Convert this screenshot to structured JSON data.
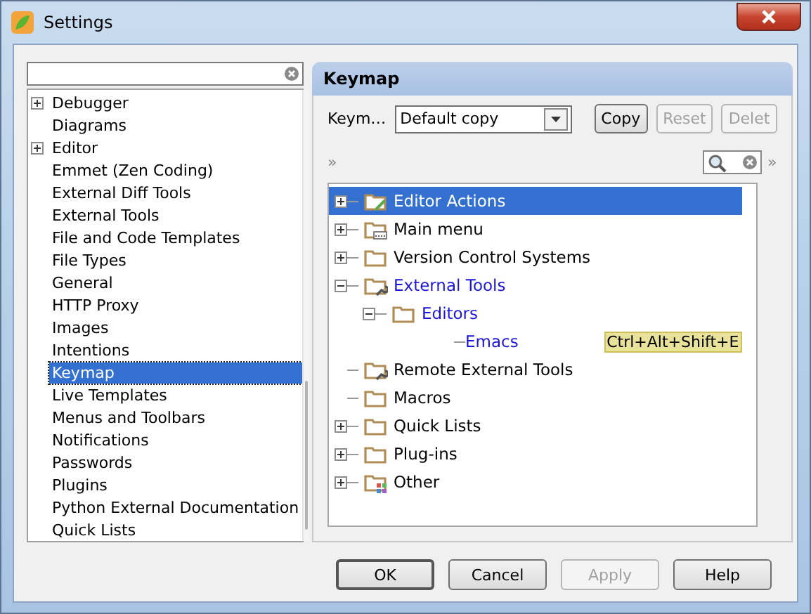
{
  "window": {
    "title": "Settings"
  },
  "sidebar": {
    "items": [
      {
        "label": "Debugger",
        "kind": "group",
        "selected": false
      },
      {
        "label": "Diagrams",
        "kind": "leaf",
        "selected": false
      },
      {
        "label": "Editor",
        "kind": "group",
        "selected": false
      },
      {
        "label": "Emmet (Zen Coding)",
        "kind": "leaf",
        "selected": false
      },
      {
        "label": "External Diff Tools",
        "kind": "leaf",
        "selected": false
      },
      {
        "label": "External Tools",
        "kind": "leaf",
        "selected": false
      },
      {
        "label": "File and Code Templates",
        "kind": "leaf",
        "selected": false
      },
      {
        "label": "File Types",
        "kind": "leaf",
        "selected": false
      },
      {
        "label": "General",
        "kind": "leaf",
        "selected": false
      },
      {
        "label": "HTTP Proxy",
        "kind": "leaf",
        "selected": false
      },
      {
        "label": "Images",
        "kind": "leaf",
        "selected": false
      },
      {
        "label": "Intentions",
        "kind": "leaf",
        "selected": false
      },
      {
        "label": "Keymap",
        "kind": "leaf",
        "selected": true
      },
      {
        "label": "Live Templates",
        "kind": "leaf",
        "selected": false
      },
      {
        "label": "Menus and Toolbars",
        "kind": "leaf",
        "selected": false
      },
      {
        "label": "Notifications",
        "kind": "leaf",
        "selected": false
      },
      {
        "label": "Passwords",
        "kind": "leaf",
        "selected": false
      },
      {
        "label": "Plugins",
        "kind": "leaf",
        "selected": false
      },
      {
        "label": "Python External Documentation",
        "kind": "leaf",
        "selected": false
      },
      {
        "label": "Quick Lists",
        "kind": "leaf",
        "selected": false
      }
    ]
  },
  "panel": {
    "title": "Keymap",
    "keymap_label": "Keym…",
    "keymap_value": "Default copy",
    "buttons": [
      {
        "label": "Copy",
        "disabled": false
      },
      {
        "label": "Reset",
        "disabled": true
      },
      {
        "label": "Delet",
        "disabled": true
      }
    ],
    "expand_left": "»",
    "expand_right": "»",
    "tree": [
      {
        "label": "Editor Actions",
        "kind": "edit",
        "expanded": false,
        "selected": true,
        "modified": false
      },
      {
        "label": "Main menu",
        "kind": "menu",
        "expanded": false,
        "selected": false,
        "modified": false
      },
      {
        "label": "Version Control Systems",
        "kind": "folder",
        "expanded": false,
        "selected": false,
        "modified": false
      },
      {
        "label": "External Tools",
        "kind": "tools",
        "expanded": true,
        "selected": false,
        "modified": true,
        "children": [
          {
            "label": "Editors",
            "kind": "folder",
            "expanded": true,
            "selected": false,
            "modified": true,
            "children": [
              {
                "label": "Emacs",
                "kind": "action",
                "selected": false,
                "modified": true,
                "shortcut": "Ctrl+Alt+Shift+E"
              }
            ]
          }
        ]
      },
      {
        "label": "Remote External Tools",
        "kind": "tools",
        "selected": false,
        "modified": false
      },
      {
        "label": "Macros",
        "kind": "folder",
        "selected": false,
        "modified": false
      },
      {
        "label": "Quick Lists",
        "kind": "folder",
        "expanded": false,
        "selected": false,
        "modified": false
      },
      {
        "label": "Plug-ins",
        "kind": "folder",
        "expanded": false,
        "selected": false,
        "modified": false
      },
      {
        "label": "Other",
        "kind": "other",
        "expanded": false,
        "selected": false,
        "modified": false
      }
    ]
  },
  "footer": {
    "buttons": [
      {
        "label": "OK",
        "disabled": false,
        "default": true
      },
      {
        "label": "Cancel",
        "disabled": false,
        "default": false
      },
      {
        "label": "Apply",
        "disabled": true,
        "default": false
      },
      {
        "label": "Help",
        "disabled": false,
        "default": false
      }
    ]
  }
}
